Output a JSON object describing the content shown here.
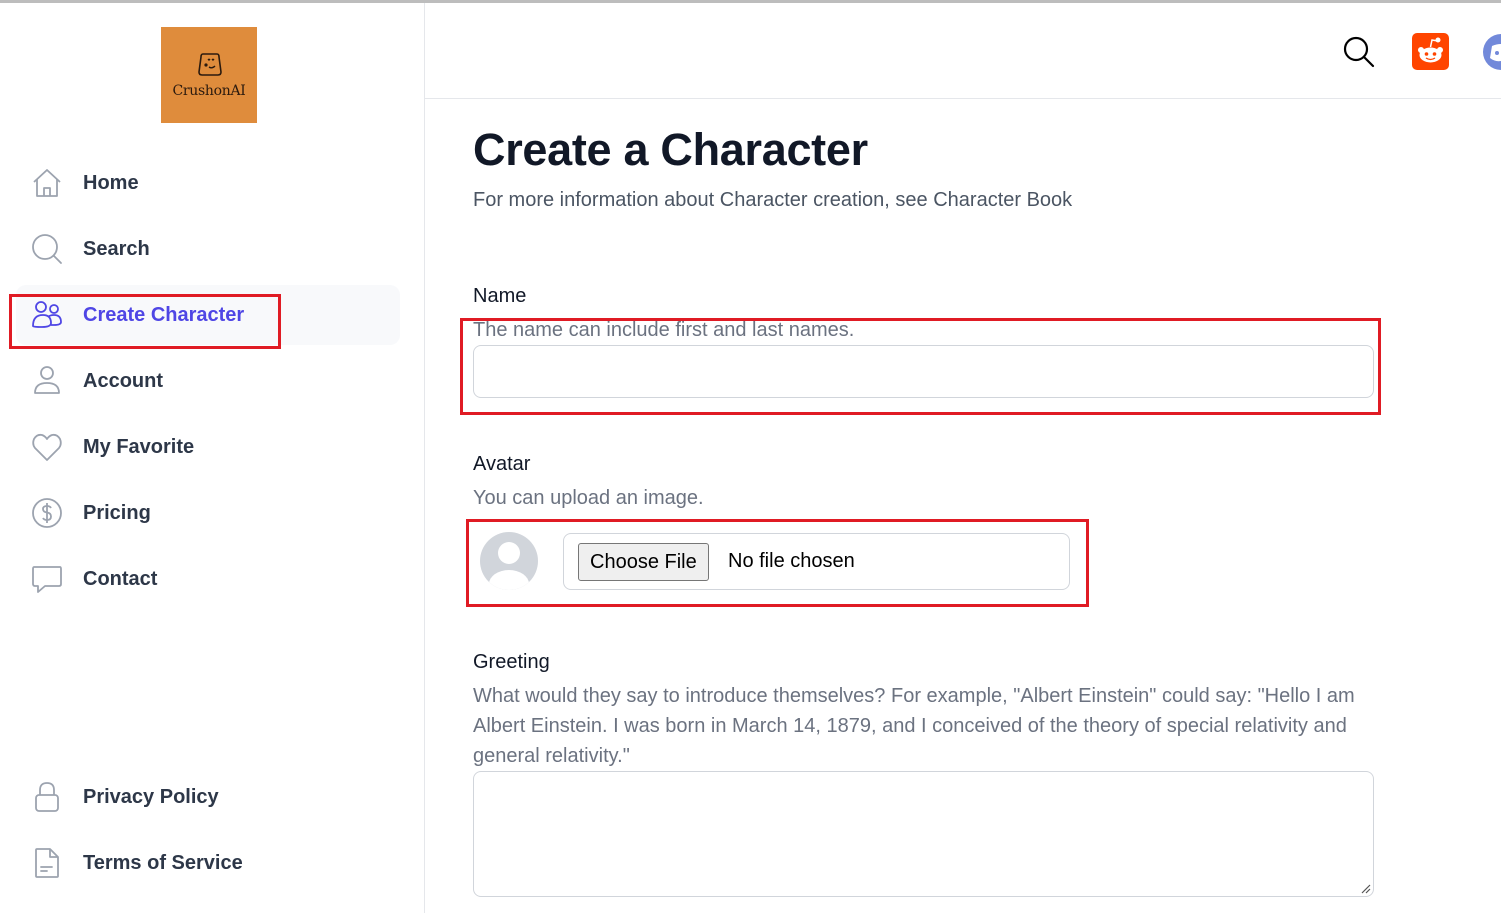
{
  "brand": {
    "name": "CrushonAI",
    "logo_bg": "#df8c3c"
  },
  "sidebar": {
    "items": [
      {
        "label": "Home",
        "icon": "home-icon",
        "active": false
      },
      {
        "label": "Search",
        "icon": "search-icon",
        "active": false
      },
      {
        "label": "Create Character",
        "icon": "users-icon",
        "active": true
      },
      {
        "label": "Account",
        "icon": "user-icon",
        "active": false
      },
      {
        "label": "My Favorite",
        "icon": "heart-icon",
        "active": false
      },
      {
        "label": "Pricing",
        "icon": "dollar-circle-icon",
        "active": false
      },
      {
        "label": "Contact",
        "icon": "chat-bubble-icon",
        "active": false
      }
    ],
    "footer_items": [
      {
        "label": "Privacy Policy",
        "icon": "lock-icon"
      },
      {
        "label": "Terms of Service",
        "icon": "document-icon"
      }
    ],
    "active_color": "#4f46e5"
  },
  "header": {
    "icons": [
      "search-icon",
      "reddit-icon",
      "discord-icon"
    ]
  },
  "page": {
    "title": "Create a Character",
    "subtitle": "For more information about Character creation, see Character Book"
  },
  "form": {
    "name": {
      "label": "Name",
      "help": "The name can include first and last names.",
      "value": ""
    },
    "avatar": {
      "label": "Avatar",
      "help": "You can upload an image.",
      "button_label": "Choose File",
      "status": "No file chosen"
    },
    "greeting": {
      "label": "Greeting",
      "help": "What would they say to introduce themselves? For example, \"Albert Einstein\" could say: \"Hello I am Albert Einstein. I was born in March 14, 1879, and I conceived of the theory of special relativity and general relativity.\"",
      "value": ""
    }
  },
  "highlight_color": "#e01b24"
}
